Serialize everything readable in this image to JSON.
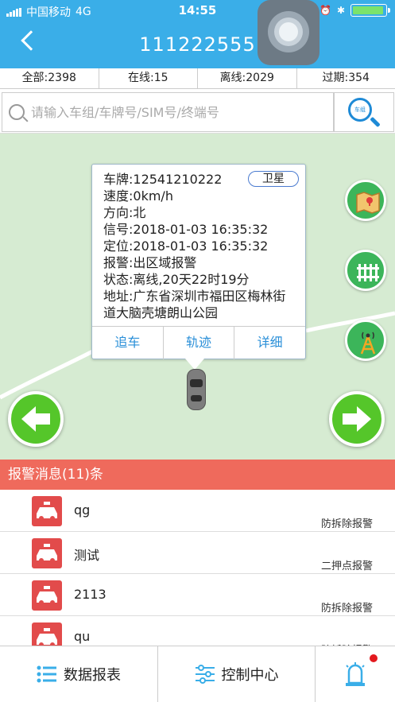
{
  "status_bar": {
    "carrier": "中国移动",
    "network": "4G",
    "time": "14:55",
    "battery_level": 0.95
  },
  "header": {
    "title": "111222555"
  },
  "stats": [
    {
      "label": "全部:2398"
    },
    {
      "label": "在线:15"
    },
    {
      "label": "离线:2029"
    },
    {
      "label": "过期:354"
    }
  ],
  "search": {
    "placeholder": "请输入车组/车牌号/SIM号/终端号",
    "button_label": "车组"
  },
  "popup": {
    "plate": "车牌:12541210222",
    "satellite_button": "卫星",
    "speed": "速度:0km/h",
    "direction": "方向:北",
    "signal": "信号:2018-01-03 16:35:32",
    "position": "定位:2018-01-03 16:35:32",
    "alarm": "报警:出区域报警",
    "state": "状态:离线,20天22时19分",
    "address": "地址:广东省深圳市福田区梅林街道大脑壳塘朗山公园",
    "actions": [
      "追车",
      "轨迹",
      "详细"
    ]
  },
  "alarm_bar": {
    "title": "报警消息(11)条"
  },
  "alarms": [
    {
      "name": "qg",
      "type": "防拆除报警"
    },
    {
      "name": "测试",
      "type": "二押点报警"
    },
    {
      "name": "2113",
      "type": "防拆除报警"
    },
    {
      "name": "qu",
      "type": "防拆除报警"
    }
  ],
  "bottom_nav": {
    "report": "数据报表",
    "control": "控制中心"
  },
  "colors": {
    "header": "#3aaee8",
    "alarm_bar": "#ef6a5c",
    "map_bg": "#d6ebd2",
    "arrow_green": "#55c62a",
    "link_blue": "#2a8fd8"
  }
}
